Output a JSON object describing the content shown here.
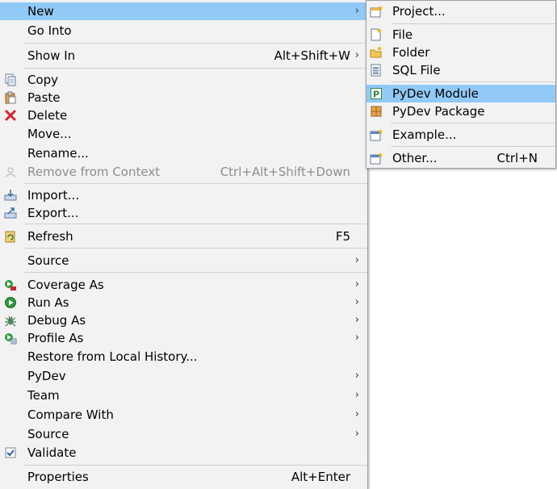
{
  "main_menu": [
    {
      "label": "New",
      "arrow": "›"
    },
    {
      "label": "Go Into"
    },
    {
      "label": "Show In",
      "accel": "Alt+Shift+W",
      "arrow": "›"
    },
    {
      "label": "Copy",
      "icon": "copy-icon"
    },
    {
      "label": "Paste",
      "icon": "paste-icon"
    },
    {
      "label": "Delete",
      "icon": "delete-icon"
    },
    {
      "label": "Move..."
    },
    {
      "label": "Rename..."
    },
    {
      "label": "Remove from Context",
      "accel": "Ctrl+Alt+Shift+Down",
      "icon": "remove-context-icon",
      "disabled": true
    },
    {
      "label": "Import...",
      "icon": "import-icon"
    },
    {
      "label": "Export...",
      "icon": "export-icon"
    },
    {
      "label": "Refresh",
      "accel": "F5",
      "icon": "refresh-icon"
    },
    {
      "label": "Source",
      "arrow": "›"
    },
    {
      "label": "Coverage As",
      "icon": "coverage-icon",
      "arrow": "›"
    },
    {
      "label": "Run As",
      "icon": "run-icon",
      "arrow": "›"
    },
    {
      "label": "Debug As",
      "icon": "debug-icon",
      "arrow": "›"
    },
    {
      "label": "Profile As",
      "icon": "profile-icon",
      "arrow": "›"
    },
    {
      "label": "Restore from Local History..."
    },
    {
      "label": "PyDev",
      "arrow": "›"
    },
    {
      "label": "Team",
      "arrow": "›"
    },
    {
      "label": "Compare With",
      "arrow": "›"
    },
    {
      "label": "Source",
      "arrow": "›"
    },
    {
      "label": "Validate",
      "icon": "validate-check-icon"
    },
    {
      "label": "Properties",
      "accel": "Alt+Enter"
    }
  ],
  "sub_menu": [
    {
      "label": "Project...",
      "icon": "new-project-icon"
    },
    {
      "label": "File",
      "icon": "new-file-icon"
    },
    {
      "label": "Folder",
      "icon": "new-folder-icon"
    },
    {
      "label": "SQL File",
      "icon": "sql-file-icon"
    },
    {
      "label": "PyDev Module",
      "icon": "pydev-module-icon"
    },
    {
      "label": "PyDev Package",
      "icon": "pydev-package-icon"
    },
    {
      "label": "Example...",
      "icon": "example-icon"
    },
    {
      "label": "Other...",
      "accel": "Ctrl+N",
      "icon": "other-wizard-icon"
    }
  ],
  "colors": {
    "highlight": "#91c9f7",
    "menu_bg": "#f2f2f2",
    "disabled_text": "#8d8d8d"
  }
}
